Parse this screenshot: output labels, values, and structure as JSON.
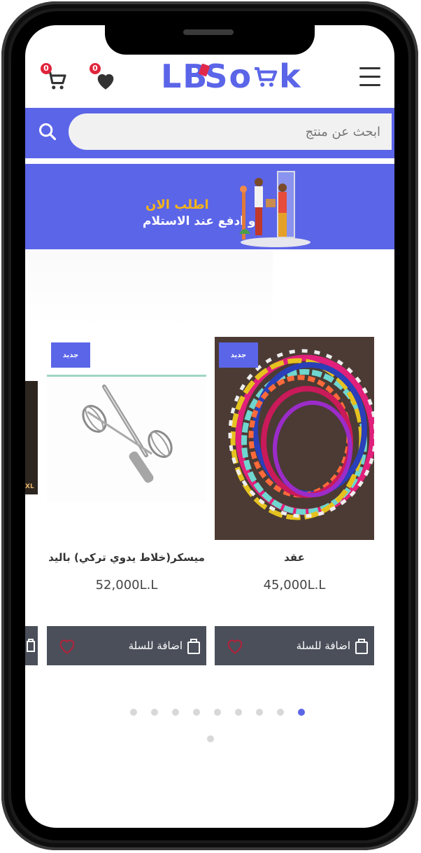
{
  "header": {
    "logo_text_left": "LB",
    "logo_text_right": "So",
    "logo_text_end": "k",
    "cart_count": "0",
    "wishlist_count": "0"
  },
  "search": {
    "placeholder": "ابحث عن منتج"
  },
  "banner": {
    "title": "اطلب الان",
    "subtitle": "و ادفع عند الاستلام"
  },
  "products": [
    {
      "tag": "جديد",
      "name": "عقد",
      "price": "45,000L.L",
      "add_label": "اضافة للسلة"
    },
    {
      "tag": "جديد",
      "name": "ميسكر(خلاط يدوي تركي) باليد",
      "price": "52,000L.L",
      "add_label": "اضافة للسلة"
    },
    {
      "partial_label": "XL"
    }
  ],
  "carousel": {
    "dots": 9,
    "active_index": 8,
    "second_row_dots": 1
  },
  "colors": {
    "accent": "#5b65e8",
    "badge": "#e0243b",
    "cart_bar": "#4a4f5a",
    "banner_title": "#f4b41a"
  }
}
